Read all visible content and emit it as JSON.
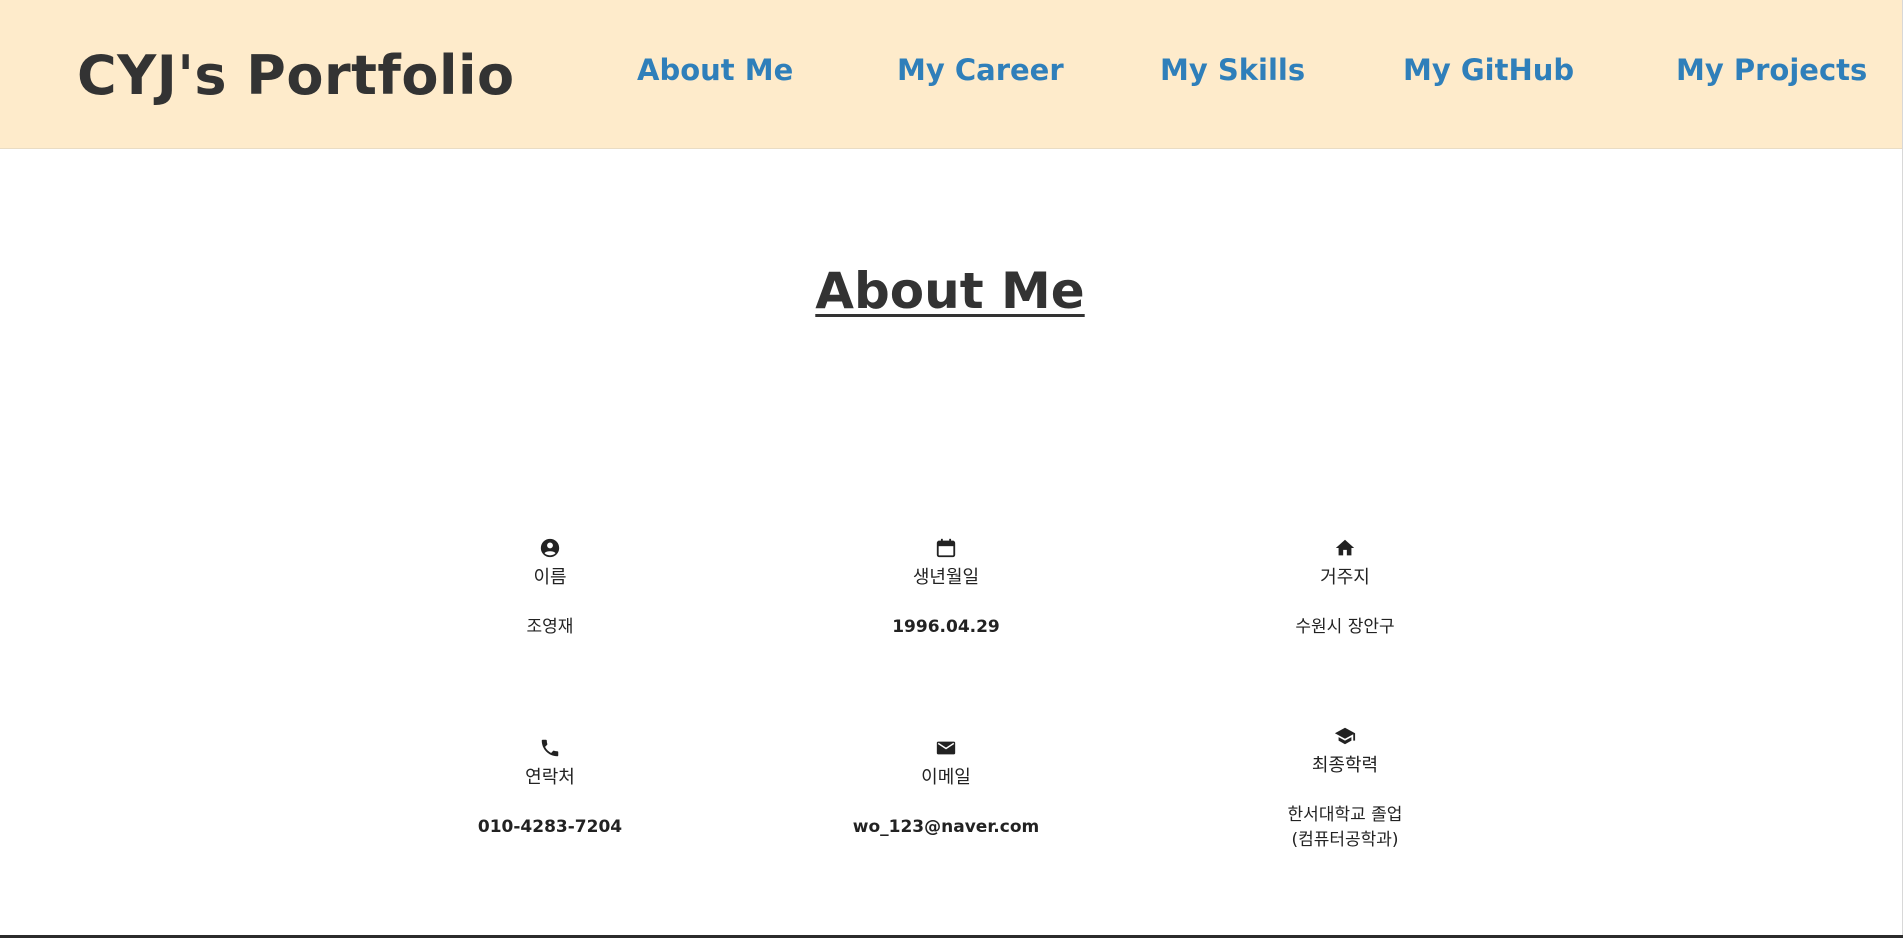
{
  "header": {
    "brand": "CYJ's Portfolio",
    "nav": [
      {
        "label": "About Me"
      },
      {
        "label": "My Career"
      },
      {
        "label": "My Skills"
      },
      {
        "label": "My GitHub"
      },
      {
        "label": "My Projects"
      }
    ],
    "background_color": "#feebcb",
    "link_color": "#2f7fba"
  },
  "about": {
    "title": "About Me",
    "items": [
      {
        "icon": "account-circle-icon",
        "label": "이름",
        "value": "조영재"
      },
      {
        "icon": "calendar-icon",
        "label": "생년월일",
        "value": "1996.04.29"
      },
      {
        "icon": "home-icon",
        "label": "거주지",
        "value": "수원시 장안구"
      },
      {
        "icon": "phone-icon",
        "label": "연락처",
        "value": "010-4283-7204"
      },
      {
        "icon": "mail-icon",
        "label": "이메일",
        "value": "wo_123@naver.com"
      },
      {
        "icon": "graduation-cap-icon",
        "label": "최종학력",
        "value_line1": "한서대학교 졸업",
        "value_line2": "(컴퓨터공학과)"
      }
    ]
  }
}
